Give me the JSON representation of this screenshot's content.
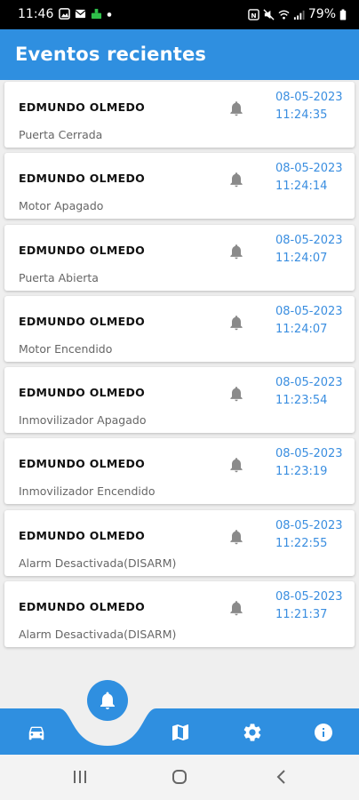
{
  "status_bar": {
    "time": "11:46",
    "battery": "79%"
  },
  "app_bar": {
    "title": "Eventos recientes"
  },
  "events": [
    {
      "name": "EDMUNDO OLMEDO",
      "event": "Puerta Cerrada",
      "datetime": "08-05-2023 11:24:35"
    },
    {
      "name": "EDMUNDO OLMEDO",
      "event": "Motor Apagado",
      "datetime": "08-05-2023 11:24:14"
    },
    {
      "name": "EDMUNDO OLMEDO",
      "event": "Puerta Abierta",
      "datetime": "08-05-2023 11:24:07"
    },
    {
      "name": "EDMUNDO OLMEDO",
      "event": "Motor Encendido",
      "datetime": "08-05-2023 11:24:07"
    },
    {
      "name": "EDMUNDO OLMEDO",
      "event": "Inmovilizador Apagado",
      "datetime": "08-05-2023 11:23:54"
    },
    {
      "name": "EDMUNDO OLMEDO",
      "event": "Inmovilizador Encendido",
      "datetime": "08-05-2023 11:23:19"
    },
    {
      "name": "EDMUNDO OLMEDO",
      "event": "Alarm Desactivada(DISARM)",
      "datetime": "08-05-2023 11:22:55"
    },
    {
      "name": "EDMUNDO OLMEDO",
      "event": "Alarm Desactivada(DISARM)",
      "datetime": "08-05-2023 11:21:37"
    }
  ],
  "bottom_nav": {
    "items": [
      {
        "icon": "car-icon"
      },
      {
        "icon": "bell-icon",
        "active": true
      },
      {
        "icon": "map-icon"
      },
      {
        "icon": "gear-icon"
      },
      {
        "icon": "info-icon"
      }
    ]
  },
  "colors": {
    "primary": "#2f8fe0",
    "date_text": "#3a8ee0",
    "bell": "#8a8a8a",
    "background": "#efefef"
  }
}
